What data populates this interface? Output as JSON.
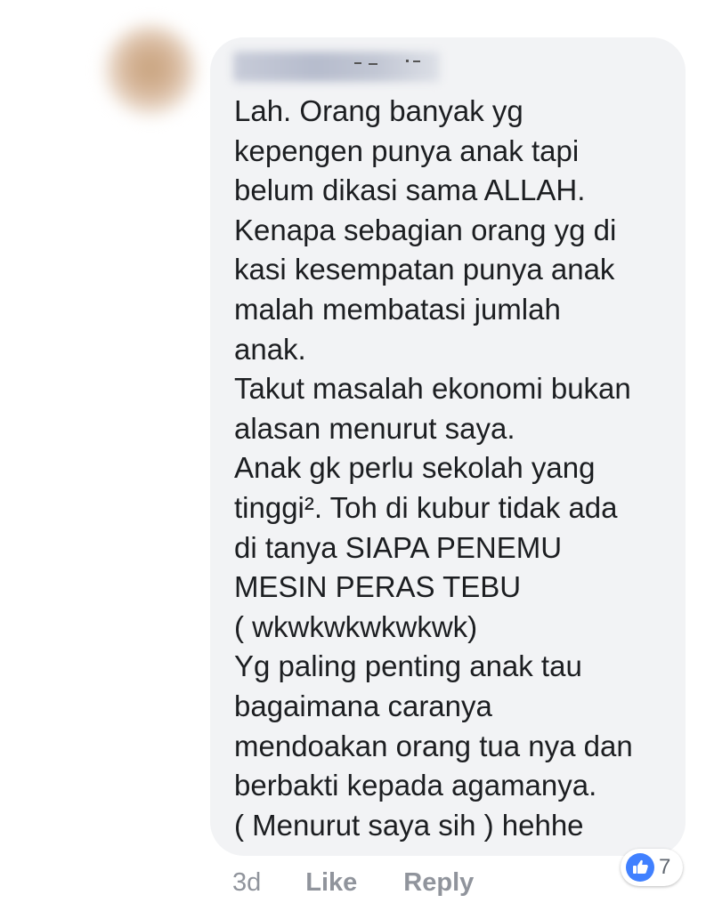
{
  "comment": {
    "text": "Lah. Orang banyak yg\nkepengen punya anak tapi\nbelum dikasi sama ALLAH.\nKenapa sebagian orang yg di\nkasi kesempatan punya anak\nmalah membatasi jumlah\nanak.\nTakut masalah ekonomi bukan\nalasan menurut saya.\nAnak gk perlu sekolah yang\ntinggi². Toh di kubur tidak ada\ndi tanya SIAPA PENEMU\nMESIN PERAS TEBU\n( wkwkwkwkwkwk)\nYg paling penting anak tau\nbagaimana caranya\nmendoakan orang tua nya dan\nberbakti kepada agamanya.\n( Menurut saya sih ) hehhe"
  },
  "actions": {
    "time": "3d",
    "like": "Like",
    "reply": "Reply"
  },
  "reactions": {
    "icon": "thumbs-up-icon",
    "count": "7",
    "color": "#4080ff"
  },
  "colors": {
    "bubble": "#f2f3f5",
    "text": "#1c1e21",
    "meta": "#90949c"
  }
}
